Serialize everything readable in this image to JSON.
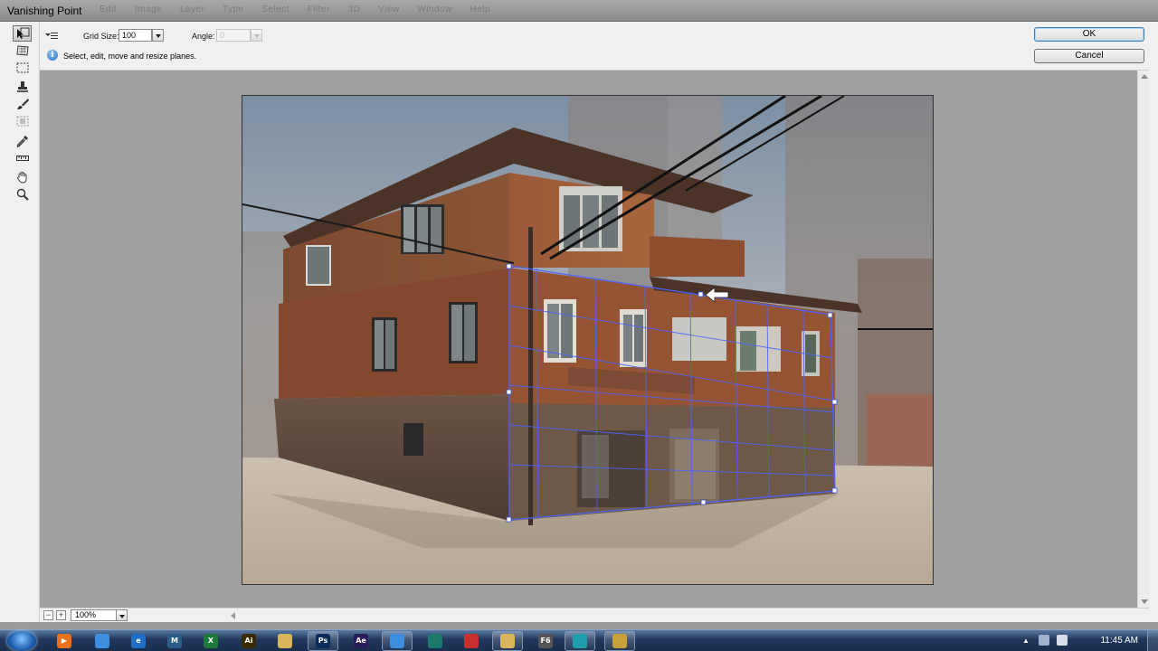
{
  "window": {
    "title": "Vanishing Point",
    "menu_ghost": [
      "Edit",
      "Image",
      "Layer",
      "Type",
      "Select",
      "Filter",
      "3D",
      "View",
      "Window",
      "Help"
    ]
  },
  "options": {
    "grid_size_label": "Grid Size:",
    "grid_size_value": "100",
    "angle_label": "Angle:",
    "angle_value": "0",
    "hint": "Select, edit, move and resize planes.",
    "ok_label": "OK",
    "cancel_label": "Cancel"
  },
  "tools": [
    {
      "name": "edit-plane-tool",
      "icon": "arrow-plane-icon",
      "active": true
    },
    {
      "name": "create-plane-tool",
      "icon": "create-plane-icon",
      "active": false
    },
    {
      "name": "marquee-tool",
      "icon": "marquee-icon",
      "active": false
    },
    {
      "name": "stamp-tool",
      "icon": "stamp-icon",
      "active": false
    },
    {
      "name": "brush-tool",
      "icon": "brush-icon",
      "active": false
    },
    {
      "name": "transform-tool",
      "icon": "transform-icon",
      "active": false
    },
    {
      "name": "eyedropper-tool",
      "icon": "eyedropper-icon",
      "active": false
    },
    {
      "name": "measure-tool",
      "icon": "ruler-icon",
      "active": false
    },
    {
      "name": "hand-tool",
      "icon": "hand-icon",
      "active": false
    },
    {
      "name": "zoom-tool",
      "icon": "magnifier-icon",
      "active": false
    }
  ],
  "status": {
    "zoom_value": "100%",
    "zoom_out": "−",
    "zoom_in": "+"
  },
  "taskbar": {
    "clock": "11:45 AM",
    "apps": [
      {
        "name": "media-player",
        "glyph": "▶",
        "color": "#e8731a",
        "open": false
      },
      {
        "name": "chrome",
        "glyph": "",
        "color": "#3b8ee0",
        "open": false
      },
      {
        "name": "edge-browser",
        "glyph": "e",
        "color": "#1d6fc7",
        "open": false
      },
      {
        "name": "maya",
        "glyph": "M",
        "color": "#2a5d8a",
        "open": false
      },
      {
        "name": "excel",
        "glyph": "X",
        "color": "#1d7a3b",
        "open": false
      },
      {
        "name": "illustrator",
        "glyph": "Ai",
        "color": "#3a2a00",
        "open": false
      },
      {
        "name": "explorer",
        "glyph": "",
        "color": "#d9b65a",
        "open": false
      },
      {
        "name": "photoshop",
        "glyph": "Ps",
        "color": "#0b2c59",
        "open": true
      },
      {
        "name": "after-effects",
        "glyph": "Ae",
        "color": "#2a1b5a",
        "open": false
      },
      {
        "name": "chrome-open",
        "glyph": "",
        "color": "#3b8ee0",
        "open": true
      },
      {
        "name": "camtasia",
        "glyph": "",
        "color": "#1b7a6b",
        "open": false
      },
      {
        "name": "acrobat",
        "glyph": "",
        "color": "#c9302c",
        "open": false
      },
      {
        "name": "folder",
        "glyph": "",
        "color": "#d9b65a",
        "open": true
      },
      {
        "name": "f6-app",
        "glyph": "F6",
        "color": "#555555",
        "open": false
      },
      {
        "name": "recorder",
        "glyph": "",
        "color": "#1e9fb0",
        "open": true
      },
      {
        "name": "tool-app",
        "glyph": "",
        "color": "#c8a13c",
        "open": true
      }
    ]
  }
}
